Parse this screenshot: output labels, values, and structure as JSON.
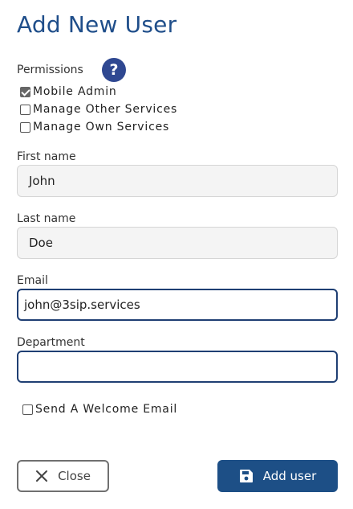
{
  "header": {
    "title": "Add New User"
  },
  "permissions": {
    "label": "Permissions",
    "help_glyph": "?",
    "options": [
      {
        "label": "Mobile Admin",
        "checked": true
      },
      {
        "label": "Manage Other Services",
        "checked": false
      },
      {
        "label": "Manage Own Services",
        "checked": false
      }
    ]
  },
  "form": {
    "first_name": {
      "label": "First name",
      "value": "John"
    },
    "last_name": {
      "label": "Last name",
      "value": "Doe"
    },
    "email": {
      "label": "Email",
      "value": "john@3sip.services"
    },
    "department": {
      "label": "Department",
      "value": ""
    }
  },
  "welcome_email": {
    "label": "Send A Welcome Email",
    "checked": false
  },
  "actions": {
    "close_label": "Close",
    "add_label": "Add user"
  },
  "colors": {
    "primary": "#1d4f86",
    "title": "#1f4e8a",
    "help_icon": "#2f4891"
  },
  "icons": {
    "help": "question-circle-icon",
    "close": "x-icon",
    "save": "floppy-disk-icon"
  }
}
